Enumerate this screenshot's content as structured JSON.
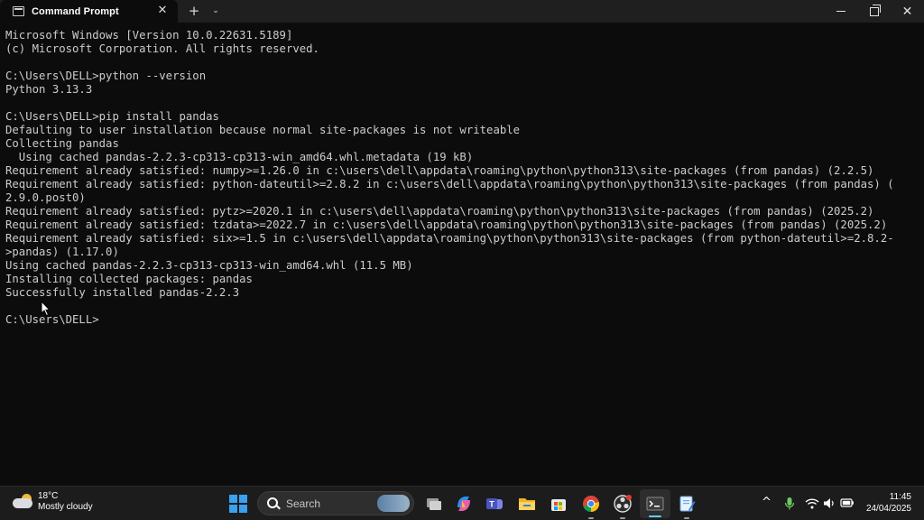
{
  "window": {
    "tab_title": "Command Prompt",
    "tab_close_glyph": "✕",
    "new_tab_glyph": "+",
    "dropdown_glyph": "⌄",
    "minimize_icon": "minimize-icon",
    "maximize_icon": "restore-icon",
    "close_glyph": "✕"
  },
  "terminal": {
    "lines": [
      "Microsoft Windows [Version 10.0.22631.5189]",
      "(c) Microsoft Corporation. All rights reserved.",
      "",
      "C:\\Users\\DELL>python --version",
      "Python 3.13.3",
      "",
      "C:\\Users\\DELL>pip install pandas",
      "Defaulting to user installation because normal site-packages is not writeable",
      "Collecting pandas",
      "  Using cached pandas-2.2.3-cp313-cp313-win_amd64.whl.metadata (19 kB)",
      "Requirement already satisfied: numpy>=1.26.0 in c:\\users\\dell\\appdata\\roaming\\python\\python313\\site-packages (from pandas) (2.2.5)",
      "Requirement already satisfied: python-dateutil>=2.8.2 in c:\\users\\dell\\appdata\\roaming\\python\\python313\\site-packages (from pandas) (",
      "2.9.0.post0)",
      "Requirement already satisfied: pytz>=2020.1 in c:\\users\\dell\\appdata\\roaming\\python\\python313\\site-packages (from pandas) (2025.2)",
      "Requirement already satisfied: tzdata>=2022.7 in c:\\users\\dell\\appdata\\roaming\\python\\python313\\site-packages (from pandas) (2025.2)",
      "Requirement already satisfied: six>=1.5 in c:\\users\\dell\\appdata\\roaming\\python\\python313\\site-packages (from python-dateutil>=2.8.2-",
      ">pandas) (1.17.0)",
      "Using cached pandas-2.2.3-cp313-cp313-win_amd64.whl (11.5 MB)",
      "Installing collected packages: pandas",
      "Successfully installed pandas-2.2.3",
      "",
      "C:\\Users\\DELL>"
    ]
  },
  "taskbar": {
    "weather": {
      "temp": "18°C",
      "condition": "Mostly cloudy",
      "icon": "partly-cloudy-icon"
    },
    "search_placeholder": "Search",
    "apps": [
      "task-view-icon",
      "copilot-icon",
      "teams-icon",
      "file-explorer-icon",
      "store-icon",
      "chrome-icon",
      "obs-icon",
      "terminal-icon",
      "notepad-icon"
    ],
    "tray": {
      "chevron": "^",
      "icons": [
        "microphone-icon",
        "wifi-icon",
        "volume-icon",
        "battery-icon"
      ]
    },
    "clock": {
      "time": "11:45",
      "date": "24/04/2025"
    }
  },
  "colors": {
    "terminal_bg": "#0c0c0c",
    "terminal_fg": "#cccccc",
    "accent": "#60cdff"
  }
}
